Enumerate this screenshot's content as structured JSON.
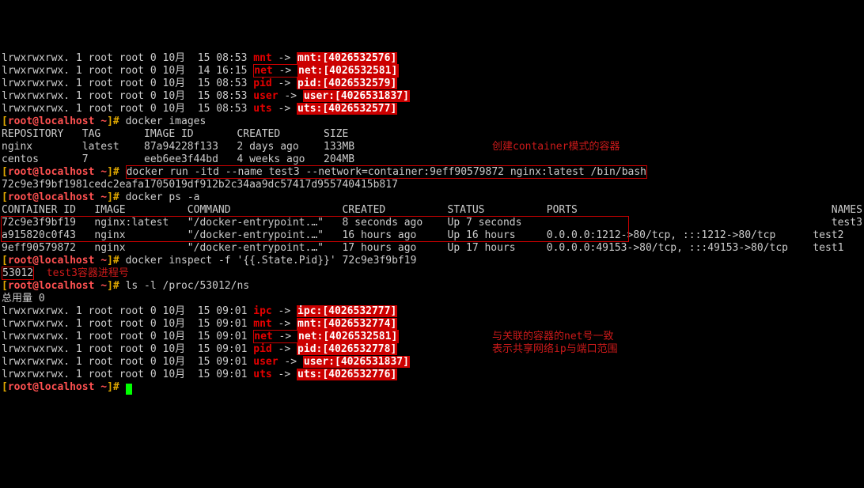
{
  "prompt": {
    "user": "root",
    "host": "localhost",
    "path": "~"
  },
  "ns1": [
    {
      "perm": "lrwxrwxrwx. 1 root root 0 10月  15 08:53 ",
      "name": "mnt",
      "target": "mnt:[4026532576]",
      "boxed": false
    },
    {
      "perm": "lrwxrwxrwx. 1 root root 0 10月  14 16:15 ",
      "name": "net",
      "target": "net:[4026532581]",
      "boxed": true
    },
    {
      "perm": "lrwxrwxrwx. 1 root root 0 10月  15 08:53 ",
      "name": "pid",
      "target": "pid:[4026532579]",
      "boxed": false
    },
    {
      "perm": "lrwxrwxrwx. 1 root root 0 10月  15 08:53 ",
      "name": "user",
      "target": "user:[4026531837]",
      "boxed": false
    },
    {
      "perm": "lrwxrwxrwx. 1 root root 0 10月  15 08:53 ",
      "name": "uts",
      "target": "uts:[4026532577]",
      "boxed": false
    }
  ],
  "cmd1": "docker images",
  "images_header": "REPOSITORY   TAG       IMAGE ID       CREATED       SIZE",
  "images": [
    "nginx        latest    87a94228f133   2 days ago    133MB",
    "centos       7         eeb6ee3f44bd   4 weeks ago   204MB"
  ],
  "anno1": "创建container模式的容器",
  "cmd2": "docker run -itd --name test3 --network=container:9eff90579872 nginx:latest /bin/bash",
  "run_out": "72c9e3f9bf1981cedc2eafa1705019df912b2c34aa9dc57417d955740415b817",
  "cmd3": "docker ps -a",
  "ps_header": "CONTAINER ID   IMAGE          COMMAND                  CREATED          STATUS          PORTS                                         NAMES",
  "ps_rows": [
    "72c9e3f9bf19   nginx:latest   \"/docker-entrypoint.…\"   8 seconds ago    Up 7 seconds                                                  test3",
    "a915820c0f43   nginx          \"/docker-entrypoint.…\"   16 hours ago     Up 16 hours     0.0.0.0:1212->80/tcp, :::1212->80/tcp      test2",
    "9eff90579872   nginx          \"/docker-entrypoint.…\"   17 hours ago     Up 17 hours     0.0.0.0:49153->80/tcp, :::49153->80/tcp    test1"
  ],
  "cmd4": "docker inspect -f '{{.State.Pid}}' 72c9e3f9bf19",
  "pid_out": "53012",
  "anno2": "test3容器进程号",
  "cmd5": "ls -l /proc/53012/ns",
  "total": "总用量 0",
  "ns2": [
    {
      "perm": "lrwxrwxrwx. 1 root root 0 10月  15 09:01 ",
      "name": "ipc",
      "target": "ipc:[4026532777]",
      "boxed": false
    },
    {
      "perm": "lrwxrwxrwx. 1 root root 0 10月  15 09:01 ",
      "name": "mnt",
      "target": "mnt:[4026532774]",
      "boxed": false
    },
    {
      "perm": "lrwxrwxrwx. 1 root root 0 10月  15 09:01 ",
      "name": "net",
      "target": "net:[4026532581]",
      "boxed": true
    },
    {
      "perm": "lrwxrwxrwx. 1 root root 0 10月  15 09:01 ",
      "name": "pid",
      "target": "pid:[4026532778]",
      "boxed": false
    },
    {
      "perm": "lrwxrwxrwx. 1 root root 0 10月  15 09:01 ",
      "name": "user",
      "target": "user:[4026531837]",
      "boxed": false
    },
    {
      "perm": "lrwxrwxrwx. 1 root root 0 10月  15 09:01 ",
      "name": "uts",
      "target": "uts:[4026532776]",
      "boxed": false
    }
  ],
  "anno3a": "与关联的容器的net号一致",
  "anno3b": "表示共享网络ip与端口范围"
}
